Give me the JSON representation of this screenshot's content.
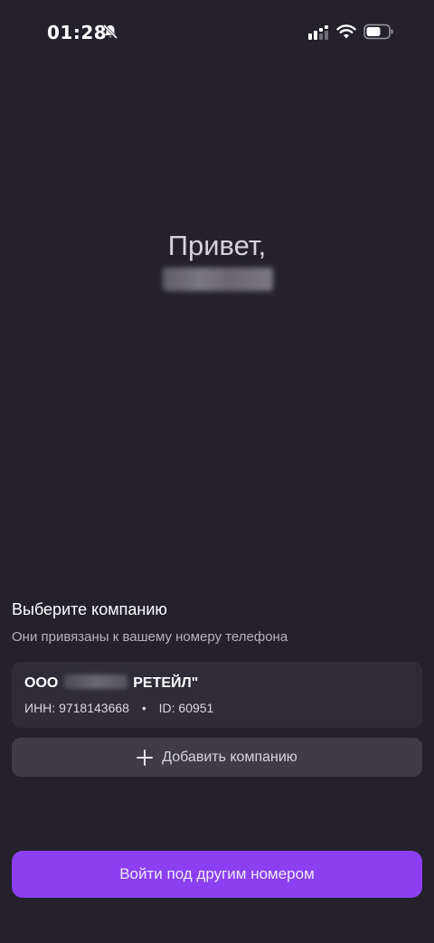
{
  "status_bar": {
    "time": "01:28",
    "icons": [
      "bell-off-icon",
      "signal-icon",
      "wifi-icon",
      "battery-icon"
    ]
  },
  "greeting": {
    "text": "Привет,"
  },
  "company_section": {
    "title": "Выберите компанию",
    "subtitle": "Они привязаны к вашему номеру телефона",
    "companies": [
      {
        "name_prefix": "ООО",
        "name_suffix": "РЕТЕЙЛ\"",
        "inn": "ИНН: 9718143668",
        "separator": "•",
        "id": "ID: 60951"
      }
    ],
    "add_button_label": "Добавить компанию"
  },
  "footer": {
    "login_other_label": "Войти под другим номером"
  },
  "colors": {
    "background": "#24212b",
    "card": "#2f2c36",
    "secondary_button": "#3f3c47",
    "accent": "#8b3ff0"
  }
}
